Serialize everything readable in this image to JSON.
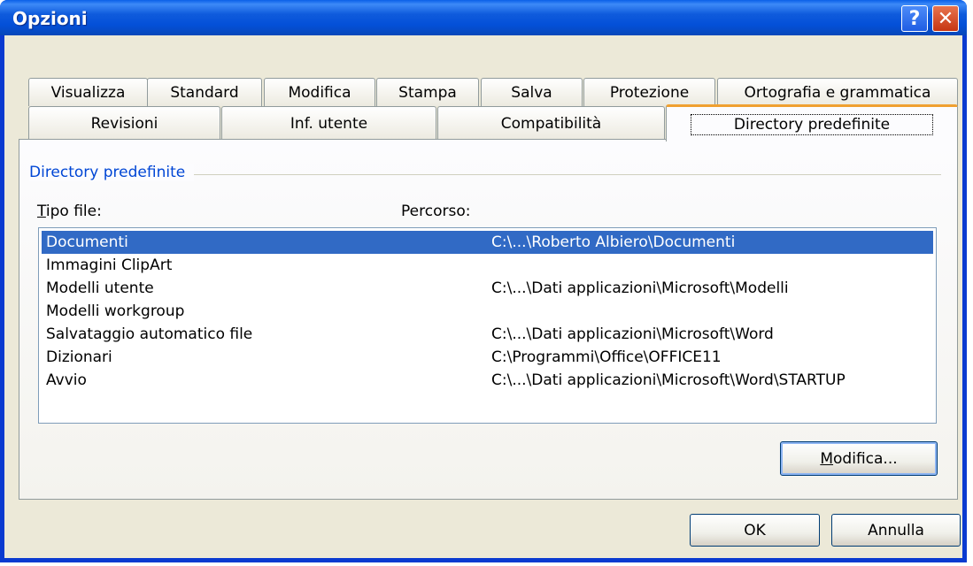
{
  "window": {
    "title": "Opzioni",
    "help_glyph": "?",
    "close_glyph": "✕"
  },
  "tabs_row1": [
    {
      "label": "Visualizza"
    },
    {
      "label": "Standard"
    },
    {
      "label": "Modifica"
    },
    {
      "label": "Stampa"
    },
    {
      "label": "Salva"
    },
    {
      "label": "Protezione"
    },
    {
      "label": "Ortografia e grammatica"
    }
  ],
  "tabs_row2": [
    {
      "label": "Revisioni"
    },
    {
      "label": "Inf. utente"
    },
    {
      "label": "Compatibilità"
    },
    {
      "label": "Directory predefinite",
      "active": true
    }
  ],
  "panel": {
    "group_label": "Directory predefinite",
    "col_tipo_first": "T",
    "col_tipo_rest": "ipo file:",
    "col_percorso": "Percorso:",
    "rows": [
      {
        "tipo": "Documenti",
        "percorso": "C:\\...\\Roberto Albiero\\Documenti",
        "selected": true
      },
      {
        "tipo": "Immagini ClipArt",
        "percorso": ""
      },
      {
        "tipo": "Modelli utente",
        "percorso": "C:\\...\\Dati applicazioni\\Microsoft\\Modelli"
      },
      {
        "tipo": "Modelli workgroup",
        "percorso": ""
      },
      {
        "tipo": "Salvataggio automatico file",
        "percorso": "C:\\...\\Dati applicazioni\\Microsoft\\Word"
      },
      {
        "tipo": "Dizionari",
        "percorso": "C:\\Programmi\\Office\\OFFICE11"
      },
      {
        "tipo": "Avvio",
        "percorso": "C:\\...\\Dati applicazioni\\Microsoft\\Word\\STARTUP"
      }
    ],
    "modify_first": "M",
    "modify_rest": "odifica..."
  },
  "footer": {
    "ok_label": "OK",
    "cancel_label": "Annulla"
  },
  "colors": {
    "title_bar": "#0a5fe8",
    "selection": "#316ac5",
    "group_label": "#0046d5",
    "active_tab_accent": "#f0a030"
  }
}
